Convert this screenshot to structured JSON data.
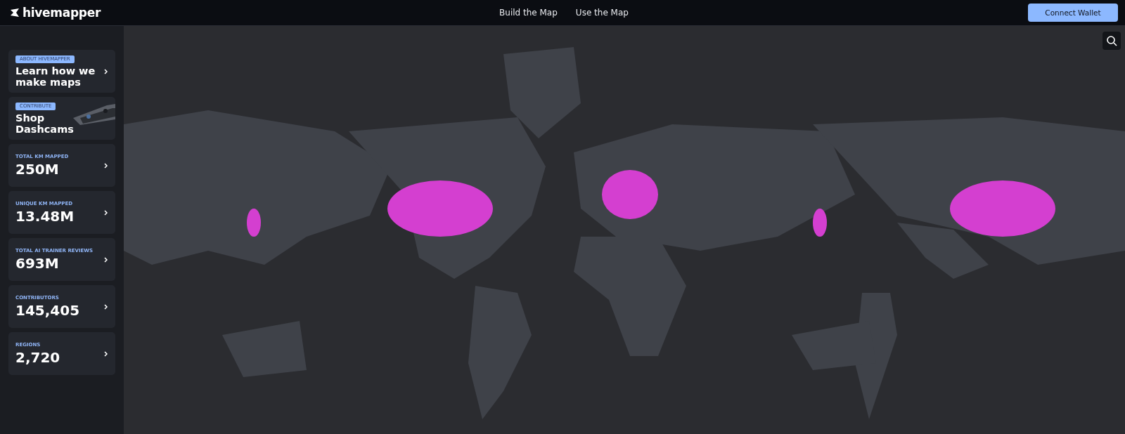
{
  "header": {
    "logo": "hivemapper",
    "nav": [
      {
        "label": "Build the Map"
      },
      {
        "label": "Use the Map"
      }
    ],
    "button": "Connect Wallet"
  },
  "sidebar": {
    "cards": [
      {
        "kind": "link",
        "badge": "ABOUT HIVEMAPPER",
        "title": "Learn how we make maps"
      },
      {
        "kind": "product",
        "badge": "CONTRIBUTE",
        "title": "Shop Dashcams"
      },
      {
        "kind": "stat",
        "label": "TOTAL KM MAPPED",
        "value": "250M"
      },
      {
        "kind": "stat",
        "label": "UNIQUE KM MAPPED",
        "value": "13.48M"
      },
      {
        "kind": "stat",
        "label": "TOTAL AI TRAINER REVIEWS",
        "value": "693M"
      },
      {
        "kind": "stat",
        "label": "CONTRIBUTORS",
        "value": "145,405"
      },
      {
        "kind": "stat",
        "label": "REGIONS",
        "value": "2,720"
      }
    ]
  }
}
